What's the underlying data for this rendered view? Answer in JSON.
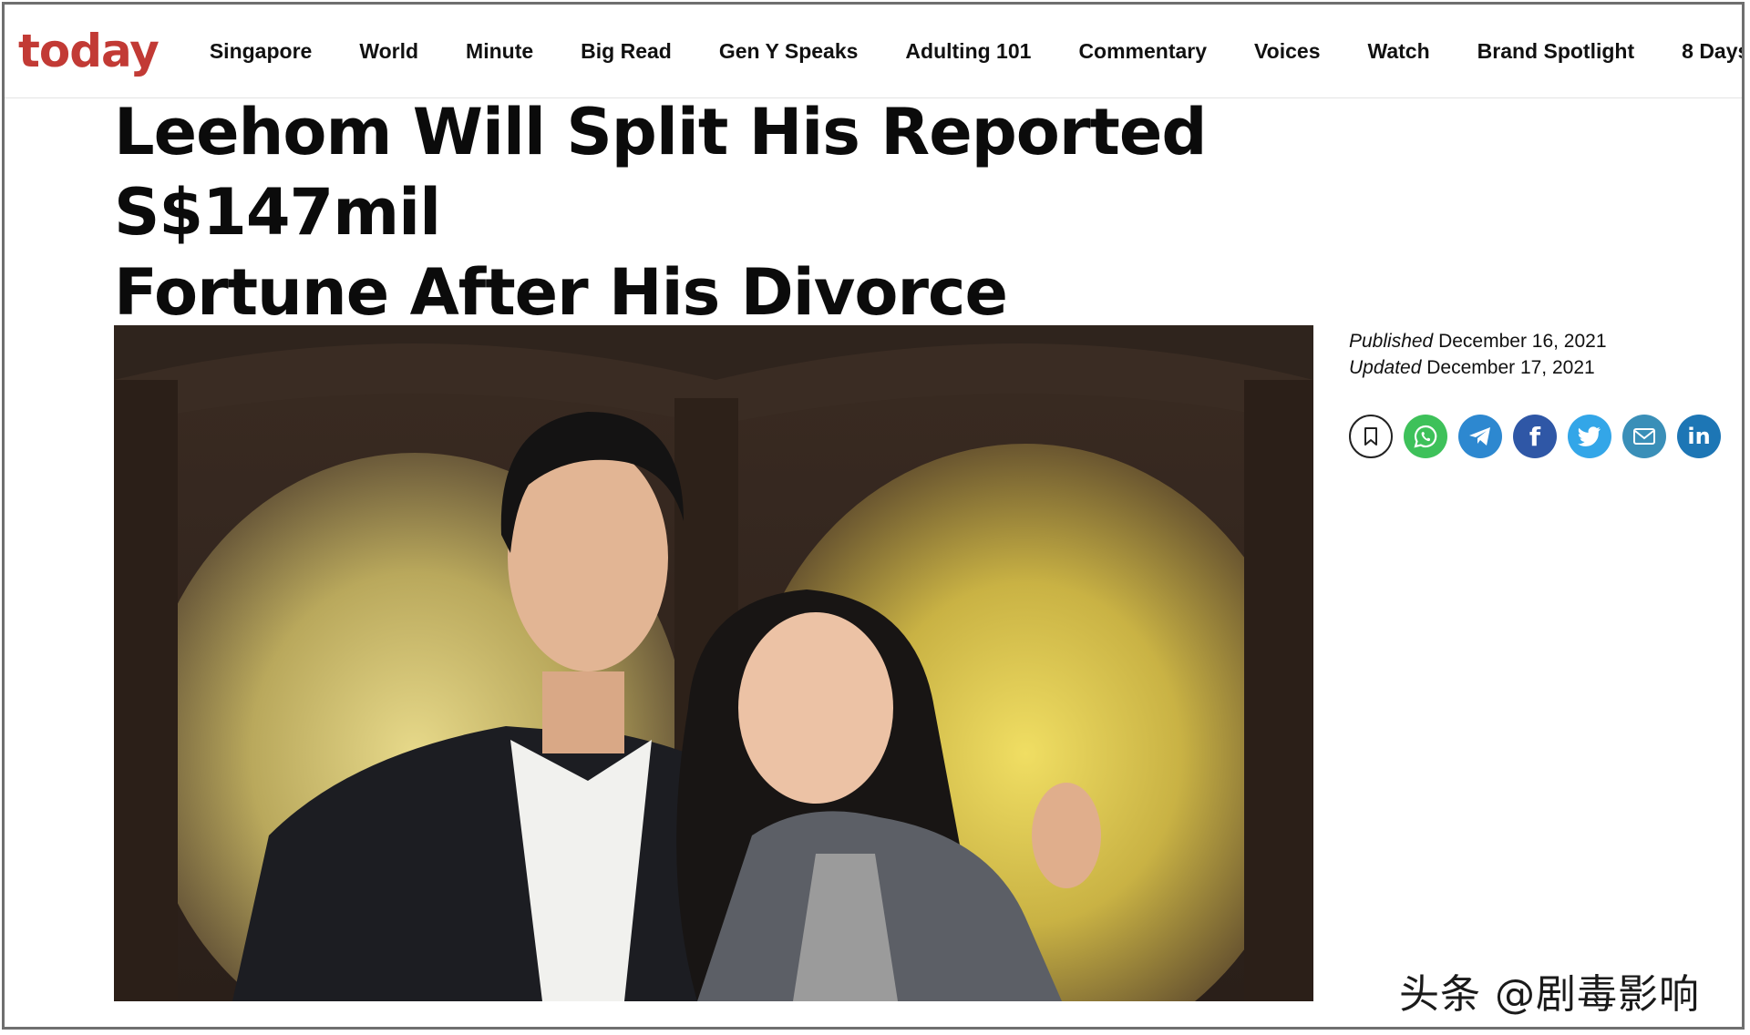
{
  "site": {
    "logo": "today",
    "nav": [
      "Singapore",
      "World",
      "Minute",
      "Big Read",
      "Gen Y Speaks",
      "Adulting 101",
      "Commentary",
      "Voices",
      "Watch",
      "Brand Spotlight",
      "8 Days"
    ]
  },
  "article": {
    "headline_line1": "Leehom Will Split His Reported S$147mil",
    "headline_line2": "Fortune After His Divorce",
    "published_label": "Published",
    "published_date": "December 16, 2021",
    "updated_label": "Updated",
    "updated_date": "December 17, 2021"
  },
  "share_icons": [
    "bookmark-icon",
    "whatsapp-icon",
    "telegram-icon",
    "facebook-icon",
    "twitter-icon",
    "email-icon",
    "linkedin-icon"
  ],
  "share_text": {
    "facebook": "f",
    "linkedin": "in"
  },
  "watermark": "头条 @剧毒影响",
  "colors": {
    "brand": "#c23a35",
    "whatsapp": "#3ec15a",
    "telegram": "#2d88d0",
    "facebook": "#2f57a6",
    "twitter": "#33a6e8",
    "email": "#3a8fb8",
    "linkedin": "#1d76b5"
  }
}
